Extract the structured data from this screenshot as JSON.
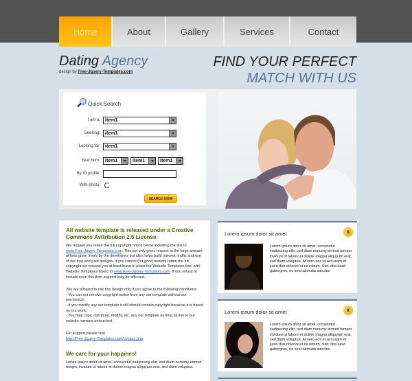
{
  "nav": {
    "items": [
      {
        "label": "Home",
        "active": true
      },
      {
        "label": "About",
        "active": false
      },
      {
        "label": "Gallery",
        "active": false
      },
      {
        "label": "Services",
        "active": false
      },
      {
        "label": "Contact",
        "active": false
      }
    ]
  },
  "header": {
    "logo_main": "Dating",
    "logo_accent": "Agency",
    "design_by_prefix": "design by",
    "design_by_link": "Free-Jquery-Templates.com",
    "tagline_line1": "FIND YOUR PERFECT",
    "tagline_line2": "MATCH WITH US"
  },
  "quick_search": {
    "title": "Quick Search",
    "fields": {
      "i_am": {
        "label": "I am a:",
        "value": "item1"
      },
      "seeking": {
        "label": "Seeking:",
        "value": "item1"
      },
      "looking_for": {
        "label": "Looking for:",
        "value": "item1"
      },
      "year_born": {
        "label": "Year born:",
        "values": [
          "item1",
          "item1",
          "item1"
        ]
      },
      "by_id": {
        "label": "By ID profile:",
        "value": ""
      },
      "with_photo": {
        "label": "With photo:"
      }
    },
    "button_label": "SEARCH NOW"
  },
  "license": {
    "heading": "All website template is released under a Creative Commons Avttribution 2.5 License",
    "para1_a": "We request you retain the full copyright notice below including the link to",
    "para1_link": "www.Free-Jquery-Templates.com",
    "para1_b": ". This not only gives respect to the large amount of time given freely by the developers but also helps build interest, traffic and use of our free and paid designs. If you cannot (for good reason) retain the full copyright we request you at least leave in place the Website Templates line, with Website Templates linked to",
    "para1_link2": "www.Free-Jquery-Templates.com",
    "para1_c": ". If you refuse to include even this then support may be affected.",
    "para2": "You are allowed to use this design only if you agree to the following conditions:",
    "cond1": "- You can not remove copyright notice from any our template without our permission.",
    "cond2": "- If you modify any our template it still should contain copyright because it is based on our work.",
    "cond3": "- You may copy, distribute, modify, etc. any our template as long as link to our website remains untouched.",
    "support_label": "For support please visit",
    "support_link": "http://Free-Jquery-Templates.com/contact.php",
    "heading2": "We care for your happines!",
    "para3": "Lorem ipsum dolor sit amet, consetetur sadipscing elitr, sed diam nonumy eirmod tempor invidunt ut labore et dolore magna aliquyam erat, sed diam voluptua."
  },
  "profiles": [
    {
      "title": "Lorem ipsum dolor sit amet",
      "close_label": "x",
      "text": "Lorem ipsum dolor sit amet, consetetur sadipscing elitr, sed diam nonumy eirmod tempor invidunt ut labore et dolore magna aliquyam erat, sed diam voluptua. At vero eos et accusam et justo duo dolores et ea rebum. Stet clita kasd gubergren, no sea takimata sanctus"
    },
    {
      "title": "Lorem ipsum dolor sit amet",
      "close_label": "x",
      "text": "Lorem ipsum dolor sit amet, consetetur sadipscing elitr, sed diam nonumy eirmod tempor invidunt ut labore et dolore magna aliquyam erat, sed diam voluptua. At vero eos et accusam et justo duo dolores et ea rebum. Stet clita kasd gubergren, no sea takimata sanctus"
    }
  ]
}
